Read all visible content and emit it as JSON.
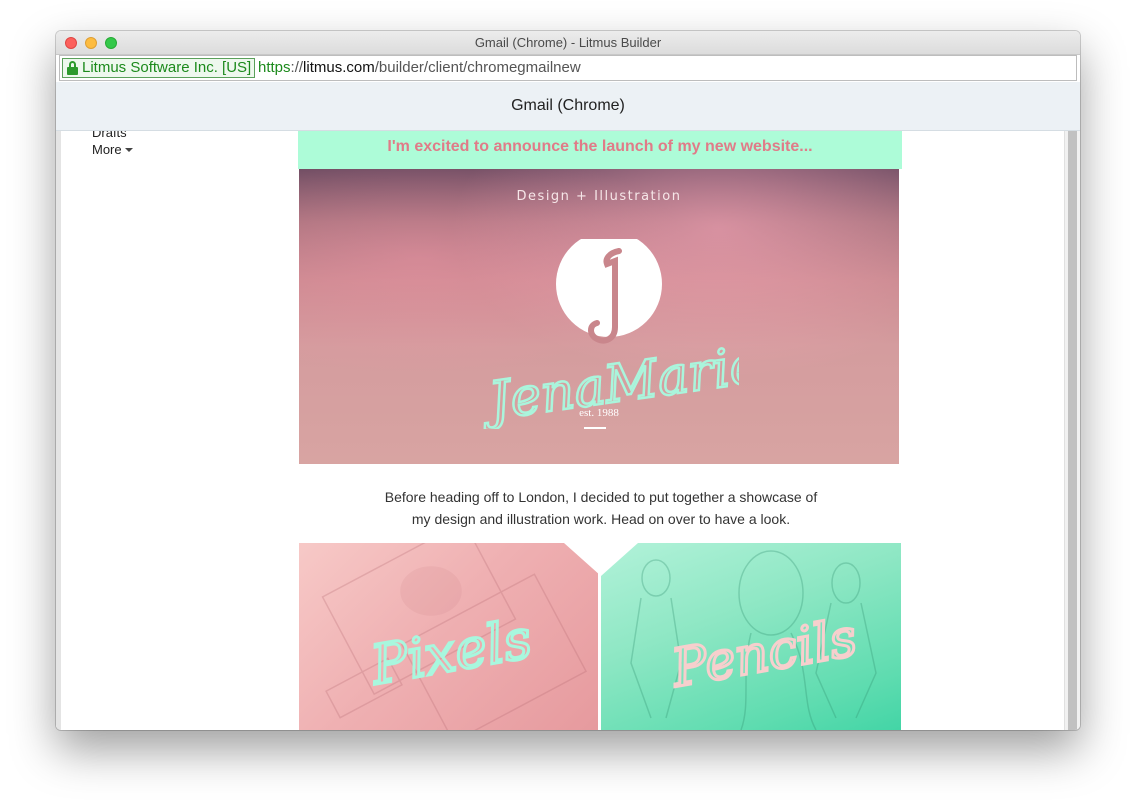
{
  "window": {
    "title": "Gmail (Chrome) - Litmus Builder"
  },
  "urlbar": {
    "secure_label": "Litmus Software Inc. [US]",
    "scheme": "https",
    "separator": "://",
    "domain": "litmus.com",
    "path": "/builder/client/chromegmailnew"
  },
  "client": {
    "name": "Gmail (Chrome)"
  },
  "gmail_nav": {
    "drafts": "Drafts",
    "more": "More"
  },
  "email": {
    "announcement": "I'm excited to announce the launch of my new website...",
    "hero": {
      "tagline": "Design + Illustration",
      "brand": "JenaMarie",
      "est": "est. 1988"
    },
    "body_line1": "Before heading off to London, I decided to put together a showcase of",
    "body_line2": "my design and illustration work. Head on over to have a look.",
    "tiles": [
      {
        "label": "Pixels"
      },
      {
        "label": "Pencils"
      }
    ]
  },
  "colors": {
    "announcement_bg": "#adfcd8",
    "announcement_text": "#e07b88",
    "mint": "#a8f7de",
    "pink": "#f4c9c8"
  }
}
